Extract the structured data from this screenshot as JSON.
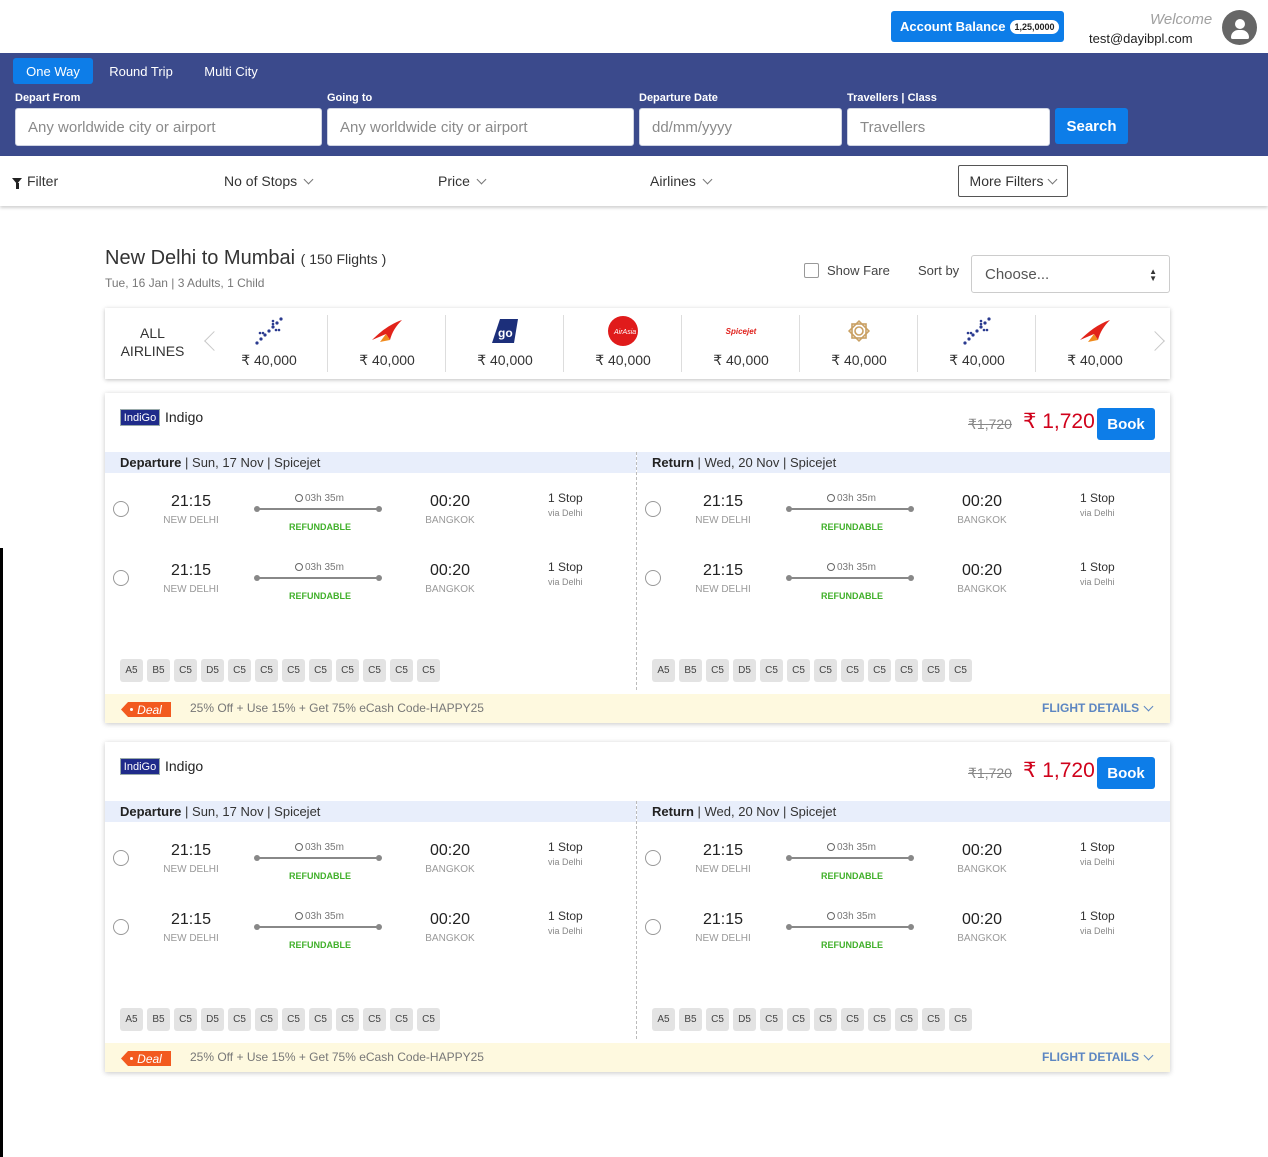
{
  "header": {
    "account_balance_label": "Account Balance",
    "account_balance_value": "1,25,0000",
    "welcome": "Welcome",
    "email": "test@dayibpl.com"
  },
  "search": {
    "tabs": [
      "One Way",
      "Round Trip",
      "Multi City"
    ],
    "active_tab": "One Way",
    "depart_label": "Depart From",
    "depart_placeholder": "Any worldwide city or airport",
    "going_label": "Going to",
    "going_placeholder": "Any worldwide city or airport",
    "date_label": "Departure Date",
    "date_placeholder": "dd/mm/yyyy",
    "travellers_label": "Travellers | Class",
    "travellers_placeholder": "Travellers",
    "search_button": "Search"
  },
  "filters": {
    "filter_label": "Filter",
    "stops_label": "No of Stops",
    "price_label": "Price",
    "airlines_label": "Airlines",
    "more_label": "More Filters"
  },
  "results": {
    "route": "New Delhi to Mumbai",
    "count": "( 150 Flights )",
    "subtitle": "Tue, 16 Jan | 3 Adults, 1 Child",
    "show_fare": "Show Fare",
    "sort_by": "Sort by",
    "sort_value": "Choose..."
  },
  "airline_strip": {
    "all_label_1": "ALL",
    "all_label_2": "AIRLINES",
    "airlines": [
      {
        "logo": "indigo-plane-icon",
        "price": "₹ 40,000"
      },
      {
        "logo": "air-india-icon",
        "price": "₹ 40,000"
      },
      {
        "logo": "goair-icon",
        "price": "₹ 40,000"
      },
      {
        "logo": "airasia-icon",
        "price": "₹ 40,000"
      },
      {
        "logo": "spicejet-icon",
        "logo_text": "Spicejet",
        "price": "₹ 40,000"
      },
      {
        "logo": "vistara-icon",
        "price": "₹ 40,000"
      },
      {
        "logo": "indigo-plane-icon",
        "price": "₹ 40,000"
      },
      {
        "logo": "air-india-icon",
        "price": "₹ 40,000"
      }
    ]
  },
  "cards": [
    {
      "logo_text": "IndiGo",
      "airline": "Indigo",
      "old_price": "₹1,720",
      "price": "₹ 1,720",
      "book": "Book",
      "departure": {
        "label": "Departure",
        "info": " | Sun, 17 Nov | Spicejet"
      },
      "return": {
        "label": "Return",
        "info": " | Wed, 20 Nov | Spicejet"
      },
      "segment": {
        "dep_time": "21:15",
        "dep_city": "NEW DELHI",
        "duration": "03h 35m",
        "status": "REFUNDABLE",
        "arr_time": "00:20",
        "arr_city": "BANGKOK",
        "stops": "1 Stop",
        "via": "via Delhi"
      },
      "classes": [
        "A5",
        "B5",
        "C5",
        "D5",
        "C5",
        "C5",
        "C5",
        "C5",
        "C5",
        "C5",
        "C5",
        "C5"
      ],
      "deal_tag": "Deal",
      "deal_text": "25% Off + Use 15% + Get 75% eCash Code-HAPPY25",
      "details": "FLIGHT DETAILS"
    },
    {
      "logo_text": "IndiGo",
      "airline": "Indigo",
      "old_price": "₹1,720",
      "price": "₹ 1,720",
      "book": "Book",
      "departure": {
        "label": "Departure",
        "info": " | Sun, 17 Nov | Spicejet"
      },
      "return": {
        "label": "Return",
        "info": " | Wed, 20 Nov | Spicejet"
      },
      "segment": {
        "dep_time": "21:15",
        "dep_city": "NEW DELHI",
        "duration": "03h 35m",
        "status": "REFUNDABLE",
        "arr_time": "00:20",
        "arr_city": "BANGKOK",
        "stops": "1 Stop",
        "via": "via Delhi"
      },
      "classes": [
        "A5",
        "B5",
        "C5",
        "D5",
        "C5",
        "C5",
        "C5",
        "C5",
        "C5",
        "C5",
        "C5",
        "C5"
      ],
      "deal_tag": "Deal",
      "deal_text": "25% Off + Use 15% + Get 75% eCash Code-HAPPY25",
      "details": "FLIGHT DETAILS"
    }
  ],
  "colors": {
    "primary": "#0d7de8",
    "panel": "#3b4a8c",
    "price_red": "#d0021b",
    "refundable_green": "#40b02a",
    "deal_orange": "#f25a1f"
  }
}
